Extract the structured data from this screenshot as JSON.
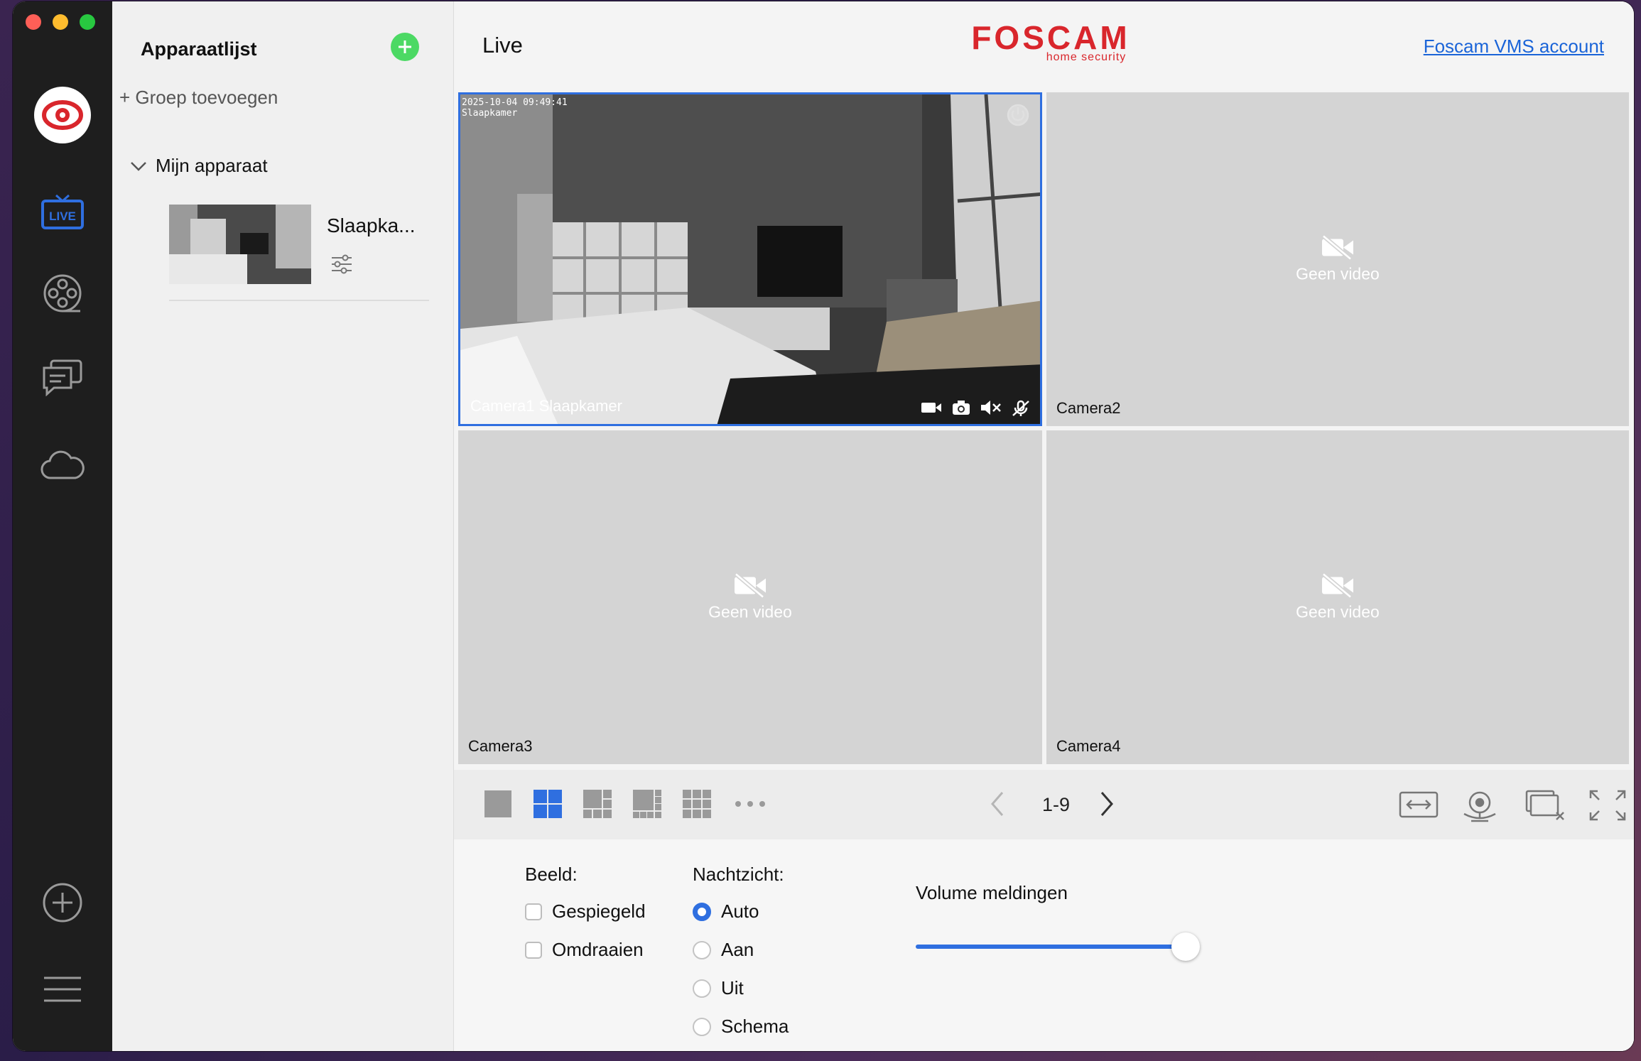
{
  "colors": {
    "accent": "#2f6fe0",
    "brand": "#d9262c",
    "add": "#4cd964",
    "link": "#1a64d8"
  },
  "rail": {
    "icons": [
      "foscam-logo-icon",
      "live-icon",
      "playback-reel-icon",
      "messages-icon",
      "cloud-icon",
      "add-device-icon",
      "menu-icon"
    ],
    "live_badge": "LIVE"
  },
  "devices": {
    "title": "Apparaatlijst",
    "add_group": "+ Groep toevoegen",
    "group_name": "Mijn apparaat",
    "items": [
      {
        "name": "Slaapka..."
      }
    ]
  },
  "header": {
    "title": "Live",
    "brand": "FOSCAM",
    "brand_sub": "home security",
    "account_link": "Foscam VMS account"
  },
  "cameras": [
    {
      "label": "Camera1 Slaapkamer",
      "osd_time": "2025-10-04 09:49:41",
      "osd_name": "Slaapkamer",
      "status": "live"
    },
    {
      "label": "Camera2",
      "status": "Geen video"
    },
    {
      "label": "Camera3",
      "status": "Geen video"
    },
    {
      "label": "Camera4",
      "status": "Geen video"
    }
  ],
  "toolbar": {
    "layouts": [
      "layout-1-icon",
      "layout-4-icon",
      "layout-6-icon",
      "layout-8-icon",
      "layout-9-icon",
      "more-icon"
    ],
    "active_layout": "layout-4-icon",
    "pager": "1-9",
    "right_icons": [
      "fit-width-icon",
      "ptz-camera-icon",
      "close-all-windows-icon",
      "fullscreen-icon"
    ]
  },
  "settings": {
    "image_heading": "Beeld:",
    "image_options": [
      "Gespiegeld",
      "Omdraaien"
    ],
    "night_heading": "Nachtzicht:",
    "night_options": [
      "Auto",
      "Aan",
      "Uit",
      "Schema"
    ],
    "night_selected": "Auto",
    "volume_label": "Volume meldingen",
    "volume_level": 0.93
  }
}
